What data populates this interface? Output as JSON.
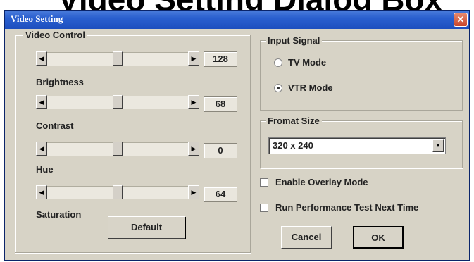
{
  "background_heading": "Video Setting Dialog Box",
  "window": {
    "title": "Video Setting",
    "close_glyph": "✕"
  },
  "video_control": {
    "label": "Video Control",
    "sliders": [
      {
        "label": "",
        "value": "128",
        "level": 0.5
      },
      {
        "label": "Brightness",
        "value": "68",
        "level": 0.5
      },
      {
        "label": "Contrast",
        "value": "0",
        "level": 0.5
      },
      {
        "label": "Hue",
        "value": "64",
        "level": 0.5
      }
    ],
    "saturation_label": "Saturation",
    "default_button": "Default",
    "arrow_left": "◀",
    "arrow_right": "▶"
  },
  "input_signal": {
    "label": "Input Signal",
    "options": [
      {
        "label": "TV Mode",
        "checked": false
      },
      {
        "label": "VTR Mode",
        "checked": true
      }
    ]
  },
  "format_size": {
    "label": "Fromat Size",
    "selected": "320 x 240",
    "dropdown_glyph": "▼"
  },
  "options": {
    "overlay": "Enable Overlay Mode",
    "perf_test": "Run Performance Test Next Time"
  },
  "buttons": {
    "cancel": "Cancel",
    "ok": "OK"
  },
  "colors": {
    "titlebar": "#2a5fcf",
    "dialog_bg": "#d7d3c6",
    "close_button": "#c9452a"
  }
}
